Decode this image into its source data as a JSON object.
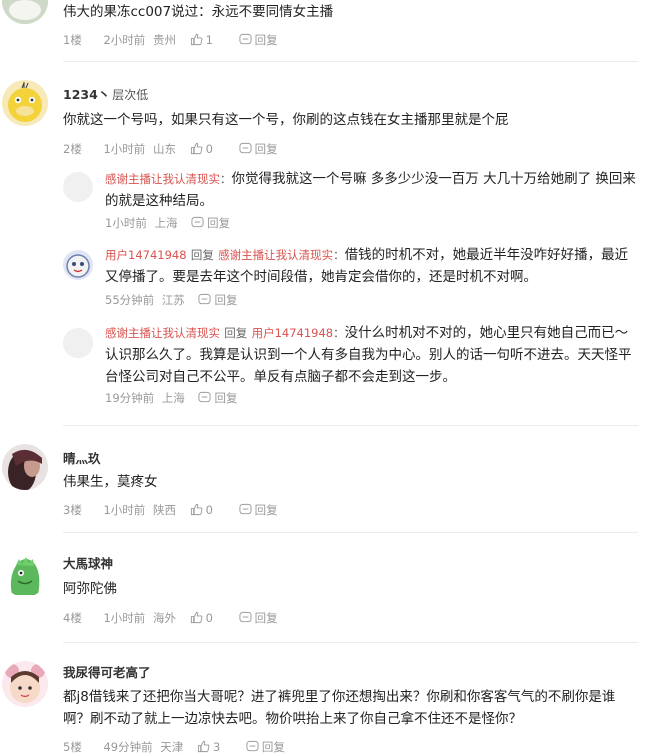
{
  "comments": [
    {
      "text": "伟大的果冻cc007说过：永远不要同情女主播",
      "floor": "1楼",
      "time": "2小时前",
      "location": "贵州",
      "likes": "1",
      "reply_label": "回复"
    },
    {
      "username": "1234丶",
      "level": "层次低",
      "text": "你就这一个号吗，如果只有这一个号，你刷的这点钱在女主播那里就是个屁",
      "floor": "2楼",
      "time": "1小时前",
      "location": "山东",
      "likes": "0",
      "reply_label": "回复",
      "replies": [
        {
          "author": "感谢主播让我认清现实",
          "sep": "：",
          "text": "你觉得我就这一个号嘛 多多少少没一百万 大几十万给她刷了 换回来的就是这种结局。",
          "time": "1小时前",
          "location": "上海",
          "reply_label": "回复"
        },
        {
          "author": "用户14741948",
          "reply_word": "回复",
          "target": "感谢主播让我认清现实",
          "sep": "：",
          "text": "借钱的时机不对，她最近半年没咋好好播，最近又停播了。要是去年这个时间段借，她肯定会借你的，还是时机不对啊。",
          "time": "55分钟前",
          "location": "江苏",
          "reply_label": "回复"
        },
        {
          "author": "感谢主播让我认清现实",
          "reply_word": "回复",
          "target": "用户14741948",
          "sep": "：",
          "text": "没什么时机对不对的，她心里只有她自己而已～认识那么久了。我算是认识到一个人有多自我为中心。别人的话一句听不进去。天天怪平台怪公司对自己不公平。单反有点脑子都不会走到这一步。",
          "time": "19分钟前",
          "location": "上海",
          "reply_label": "回复"
        }
      ]
    },
    {
      "username": "晴灬玖",
      "text": "伟果生，莫疼女",
      "floor": "3楼",
      "time": "1小时前",
      "location": "陕西",
      "likes": "0",
      "reply_label": "回复"
    },
    {
      "username": "大馬球神",
      "text": "阿弥陀佛",
      "floor": "4楼",
      "time": "1小时前",
      "location": "海外",
      "likes": "0",
      "reply_label": "回复"
    },
    {
      "username": "我尿得可老高了",
      "text": "都j8借钱来了还把你当大哥呢？进了裤兜里了你还想掏出来？你刷和你客客气气的不刷你是谁啊？刷不动了就上一边凉快去吧。物价哄抬上来了你自己拿不住还不是怪你？",
      "floor": "5楼",
      "time": "49分钟前",
      "location": "天津",
      "likes": "3",
      "reply_label": "回复"
    }
  ],
  "icons": {
    "like": "thumbs-up-icon",
    "reply": "reply-bubble-icon"
  }
}
